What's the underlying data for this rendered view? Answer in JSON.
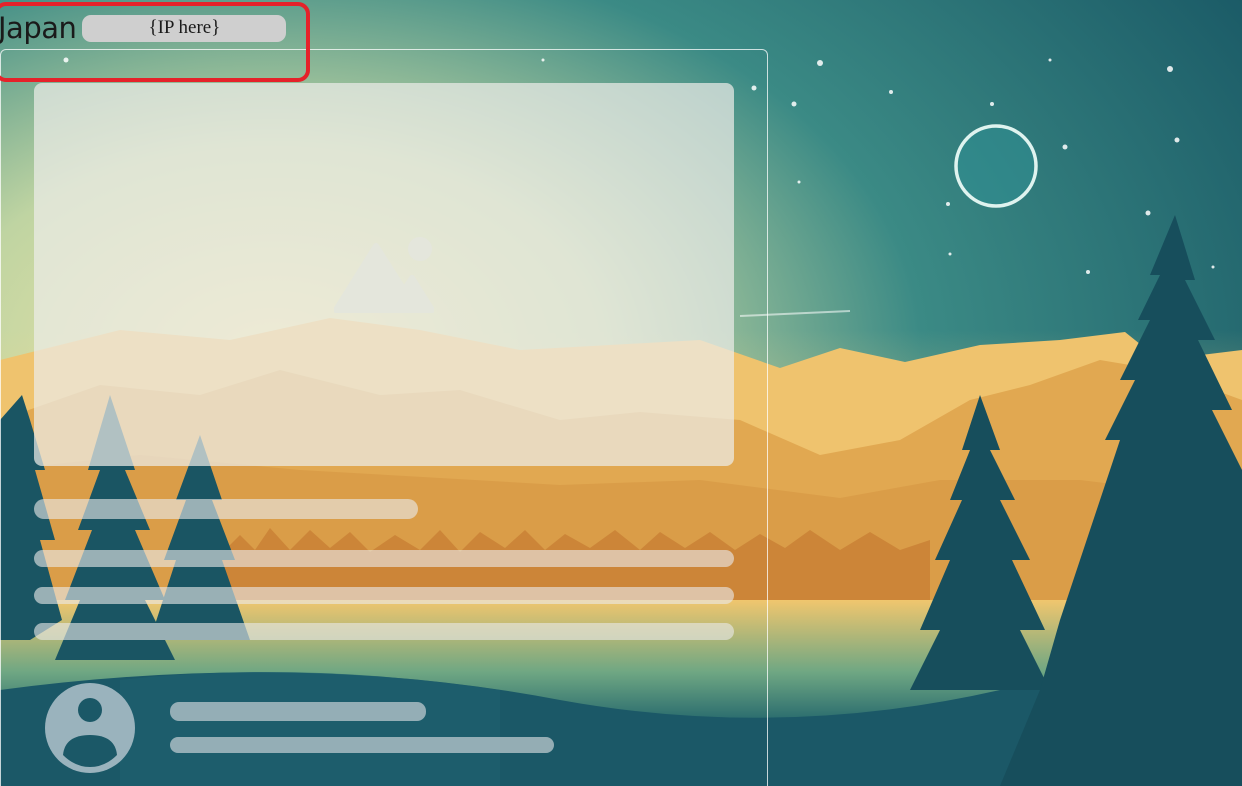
{
  "header": {
    "country": "Japan",
    "ip_placeholder": "{IP here}"
  },
  "icons": {
    "image_placeholder": "image-placeholder-icon",
    "avatar": "user-avatar-icon",
    "moon": "moon"
  },
  "colors": {
    "highlight": "#e5222a",
    "sky_top": "#1b5866",
    "sky_glow": "#c9d6a0",
    "mountain": "#e2ab55",
    "trees": "#174e5c",
    "skeleton": "#e8e8e8"
  }
}
